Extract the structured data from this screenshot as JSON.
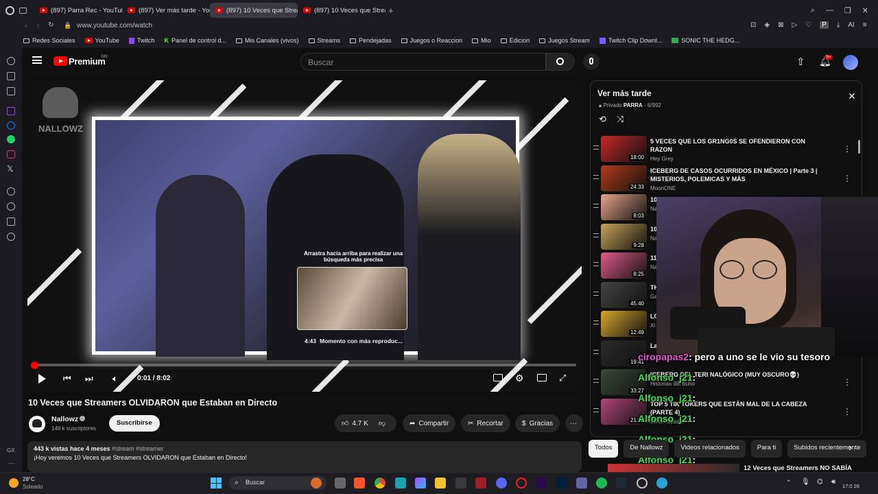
{
  "browser": {
    "tabs": [
      {
        "label": "(897) Parra Rec - YouTube"
      },
      {
        "label": "(897) Ver más tarde - You"
      },
      {
        "label": "(897) 10 Veces que Strean"
      },
      {
        "label": "(897) 10 Veces que Strean"
      }
    ],
    "url": "www.youtube.com/watch",
    "bookmarks": [
      "Redes Sociales",
      "YouTube",
      "Twitch",
      "Panel de control d...",
      "Mis Canales (vivos)",
      "Streams",
      "Pendejadas",
      "Juegos o Reaccion",
      "Mio",
      "Edicion",
      "Juegos Stream",
      "Twitch Clip Downl...",
      "SONIC THE HEDG..."
    ],
    "profile_letter": "P",
    "ai_label": "AI"
  },
  "youtube": {
    "logo": "Premium",
    "region": "MX",
    "search_placeholder": "Buscar",
    "notifications": "9+"
  },
  "player": {
    "watermark": "NALLOWZ",
    "drag_hint": "Arrastra hacia arriba para realizar una búsqueda más precisa",
    "preview_time": "4:43",
    "preview_label": "Momento con más reproduc...",
    "time": "0:01 / 8:02",
    "progress_fraction": 0.0
  },
  "video": {
    "title": "10 Veces que Streamers OLVIDARON que Estaban en Directo",
    "channel": "Nallowz",
    "subscribers": "146 k suscriptores",
    "subscribe": "Suscribirse",
    "likes": "4.7 K",
    "share": "Compartir",
    "clip": "Recortar",
    "thanks": "Gracias",
    "views": "443 k vistas",
    "age": "hace 4 meses",
    "tags": "#stream #streamer",
    "description": "¡Hoy veremos 10 Veces que Streamers OLVIDARON que Estaban en Directo!"
  },
  "playlist": {
    "title": "Ver más tarde",
    "privacy": "Privado",
    "owner": "PARRA",
    "position": "- 6/992",
    "items": [
      {
        "title": "5 VECES QUE LOS GR1NG0S SE OFENDIERON CON RAZON",
        "channel": "Hey Grey",
        "duration": "18:00"
      },
      {
        "title": "ICEBERG DE CASOS OCURRIDOS EN MÉXICO | Parte 3 | MISTERIOS, POLEMICAS Y MÁS",
        "channel": "MoonONE",
        "duration": "24:33"
      },
      {
        "title": "10",
        "channel": "Na",
        "duration": "8:03"
      },
      {
        "title": "10",
        "channel": "Na",
        "duration": "9:28"
      },
      {
        "title": "11",
        "channel": "Na",
        "duration": "8:25"
      },
      {
        "title": "TH",
        "channel": "Ga",
        "duration": "45:40"
      },
      {
        "title": "LO",
        "channel": "Xi",
        "duration": "12:49"
      },
      {
        "title": "La",
        "channel": "",
        "duration": "19:41"
      },
      {
        "title": "ICEBERG DEL TERI NALÓGICO (MUY OSCURO💀)",
        "channel": "Historias del Buho",
        "duration": "33:27"
      },
      {
        "title": "TOP 5 TIK TOKERS QUE ESTÁN MAL DE LA CABEZA (PARTE 4)",
        "channel": "Johan Speak",
        "duration": "21:22"
      }
    ]
  },
  "chat": [
    {
      "user": "ciropapas2",
      "message": ": pero a uno se le vio su tesoro"
    },
    {
      "user": "Alfonso_j21",
      "message": ":"
    },
    {
      "user": "Alfonso_j21",
      "message": ":"
    },
    {
      "user": "Alfonso_j21",
      "message": ":"
    },
    {
      "user": "Alfonso_j21",
      "message": ":"
    },
    {
      "user": "Alfonso_j21",
      "message": ":"
    }
  ],
  "chips": [
    "Todos",
    "De Nallowz",
    "Videos relacionados",
    "Para ti",
    "Subidos recientemente"
  ],
  "next_video": "12 Veces que Streamers NO SABÍA",
  "taskbar": {
    "temperature": "28°C",
    "weather": "Soleado",
    "search": "Buscar",
    "clock": "17:0 26"
  },
  "colors": {
    "accent_red": "#ff0000",
    "chat_green": "#3ce04b",
    "chat_pink": "#e955d6"
  }
}
